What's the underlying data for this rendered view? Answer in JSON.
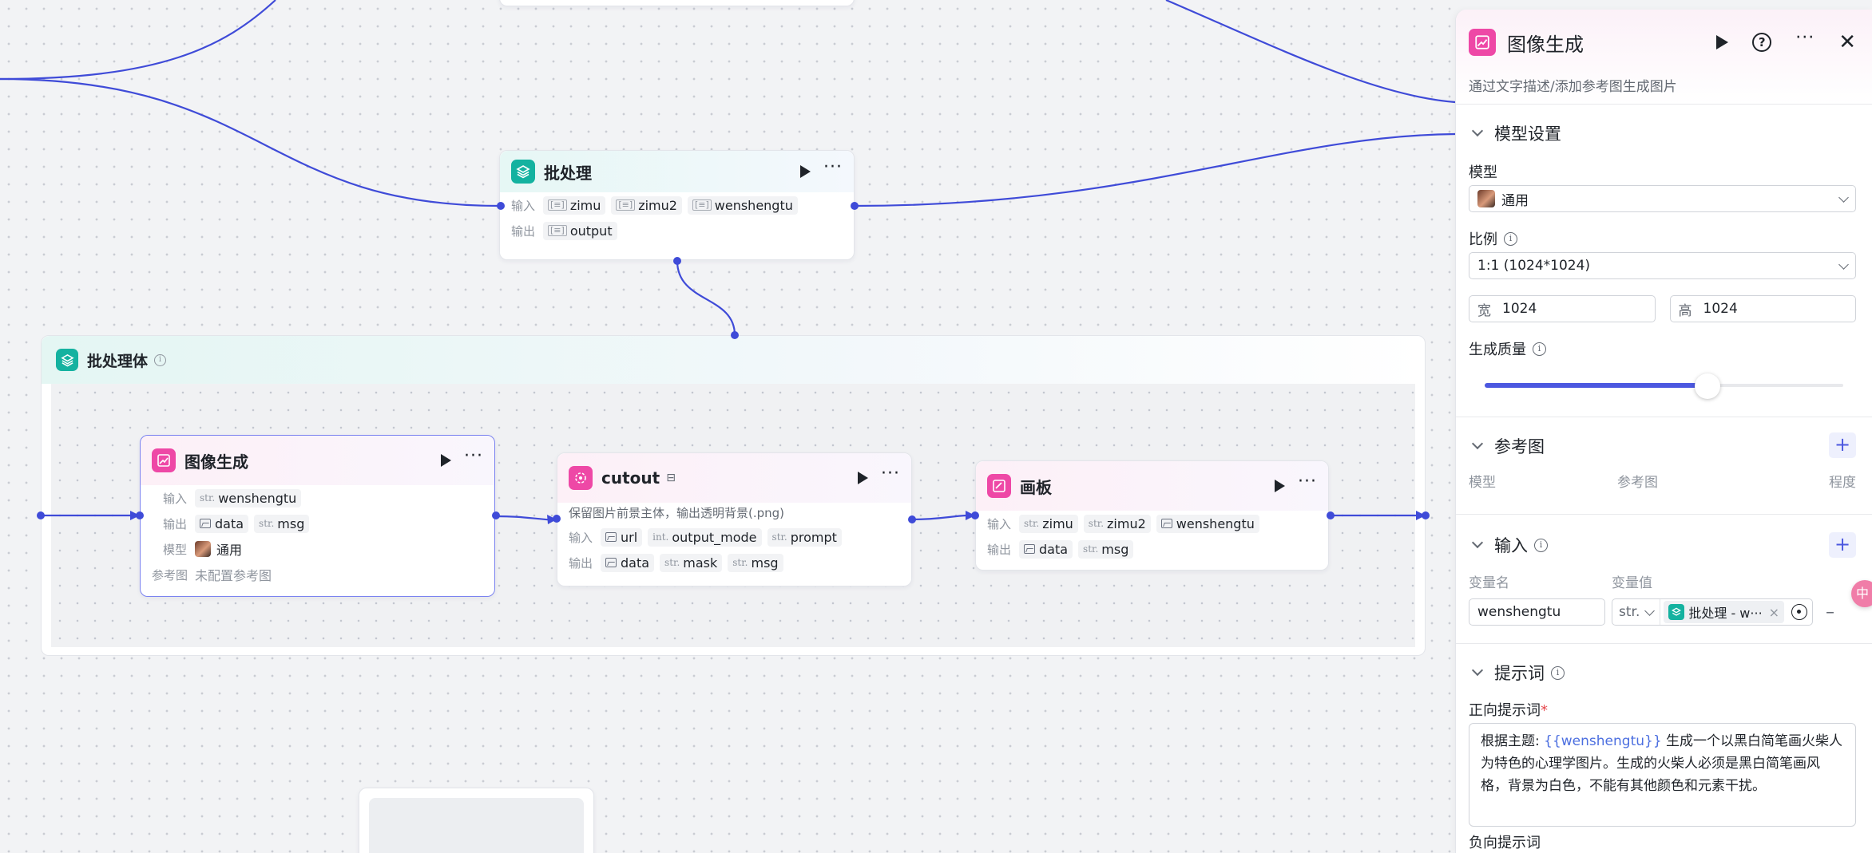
{
  "nodes": {
    "batch": {
      "title": "批处理",
      "input_label": "输入",
      "output_label": "输出",
      "inputs": [
        "zimu",
        "zimu2",
        "wenshengtu"
      ],
      "outputs": [
        "output"
      ]
    },
    "group": {
      "title": "批处理体"
    },
    "image_gen": {
      "title": "图像生成",
      "input_label": "输入",
      "output_label": "输出",
      "model_label": "模型",
      "ref_label": "参考图",
      "inputs": [
        {
          "type": "str.",
          "name": "wenshengtu"
        }
      ],
      "outputs": [
        {
          "type": "img",
          "name": "data"
        },
        {
          "type": "str.",
          "name": "msg"
        }
      ],
      "model": "通用",
      "ref_value": "未配置参考图"
    },
    "cutout": {
      "title": "cutout",
      "desc": "保留图片前景主体，输出透明背景(.png)",
      "input_label": "输入",
      "output_label": "输出",
      "inputs": [
        {
          "type": "img",
          "name": "url"
        },
        {
          "type": "int.",
          "name": "output_mode"
        },
        {
          "type": "str.",
          "name": "prompt"
        }
      ],
      "outputs": [
        {
          "type": "img",
          "name": "data"
        },
        {
          "type": "str.",
          "name": "mask"
        },
        {
          "type": "str.",
          "name": "msg"
        }
      ]
    },
    "canvas": {
      "title": "画板",
      "input_label": "输入",
      "output_label": "输出",
      "inputs": [
        {
          "type": "str.",
          "name": "zimu"
        },
        {
          "type": "str.",
          "name": "zimu2"
        },
        {
          "type": "img",
          "name": "wenshengtu"
        }
      ],
      "outputs": [
        {
          "type": "img",
          "name": "data"
        },
        {
          "type": "str.",
          "name": "msg"
        }
      ]
    }
  },
  "panel": {
    "title": "图像生成",
    "subtitle": "通过文字描述/添加参考图生成图片",
    "model_section": "模型设置",
    "model_label": "模型",
    "model_value": "通用",
    "ratio_label": "比例",
    "ratio_value": "1:1 (1024*1024)",
    "width_label": "宽",
    "width_value": "1024",
    "height_label": "高",
    "height_value": "1024",
    "quality_label": "生成质量",
    "quality_fraction": 0.62,
    "ref_section": "参考图",
    "ref_cols": [
      "模型",
      "参考图",
      "程度"
    ],
    "input_section": "输入",
    "var_name_col": "变量名",
    "var_value_col": "变量值",
    "var_name": "wenshengtu",
    "var_type": "str.",
    "var_ref": "批处理 - w···",
    "prompt_section": "提示词",
    "pos_prompt_label": "正向提示词",
    "required_mark": "*",
    "prompt_prefix": "根据主题:",
    "prompt_var": "{{wenshengtu}}",
    "prompt_rest": "生成一个以黑白简笔画火柴人为特色的心理学图片。生成的火柴人必须是黑白简笔画风格，背景为白色，不能有其他颜色和元素干扰。",
    "neg_prompt_label": "负向提示词",
    "floating_badge": "中"
  },
  "colors": {
    "edge": "#3f4bd8",
    "teal": "#14b2a0",
    "pink": "#ee48a6",
    "accent": "#4c58e0"
  }
}
